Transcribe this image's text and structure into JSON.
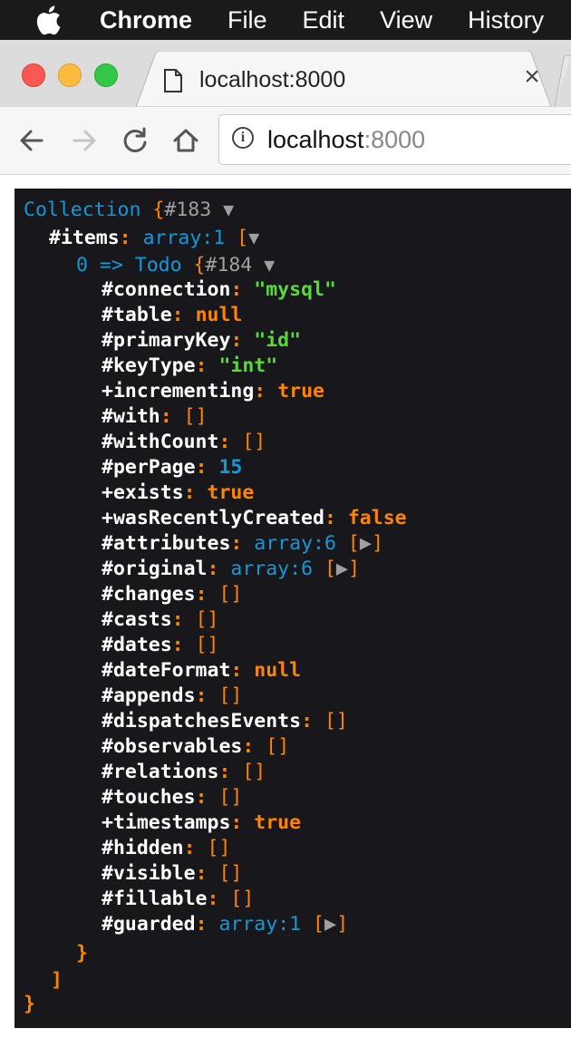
{
  "menubar": {
    "app_name": "Chrome",
    "items": [
      "File",
      "Edit",
      "View",
      "History"
    ]
  },
  "tab": {
    "title": "localhost:8000",
    "close_symbol": "×"
  },
  "omnibox": {
    "host": "localhost",
    "port": ":8000"
  },
  "dump": {
    "root_class": "Collection",
    "root_ref": "#183",
    "items_key": "#items",
    "items_type": "array:1",
    "item_index": "0",
    "arrow": "=>",
    "item_class": "Todo",
    "item_ref": "#184",
    "properties": [
      {
        "key": "#connection",
        "type": "string",
        "value": "\"mysql\""
      },
      {
        "key": "#table",
        "type": "null",
        "value": "null"
      },
      {
        "key": "#primaryKey",
        "type": "string",
        "value": "\"id\""
      },
      {
        "key": "#keyType",
        "type": "string",
        "value": "\"int\""
      },
      {
        "key": "+incrementing",
        "type": "bool",
        "value": "true"
      },
      {
        "key": "#with",
        "type": "empty",
        "value": "[]"
      },
      {
        "key": "#withCount",
        "type": "empty",
        "value": "[]"
      },
      {
        "key": "#perPage",
        "type": "number",
        "value": "15"
      },
      {
        "key": "+exists",
        "type": "bool",
        "value": "true"
      },
      {
        "key": "+wasRecentlyCreated",
        "type": "bool",
        "value": "false"
      },
      {
        "key": "#attributes",
        "type": "array",
        "value": "array:6"
      },
      {
        "key": "#original",
        "type": "array",
        "value": "array:6"
      },
      {
        "key": "#changes",
        "type": "empty",
        "value": "[]"
      },
      {
        "key": "#casts",
        "type": "empty",
        "value": "[]"
      },
      {
        "key": "#dates",
        "type": "empty",
        "value": "[]"
      },
      {
        "key": "#dateFormat",
        "type": "null",
        "value": "null"
      },
      {
        "key": "#appends",
        "type": "empty",
        "value": "[]"
      },
      {
        "key": "#dispatchesEvents",
        "type": "empty",
        "value": "[]"
      },
      {
        "key": "#observables",
        "type": "empty",
        "value": "[]"
      },
      {
        "key": "#relations",
        "type": "empty",
        "value": "[]"
      },
      {
        "key": "#touches",
        "type": "empty",
        "value": "[]"
      },
      {
        "key": "+timestamps",
        "type": "bool",
        "value": "true"
      },
      {
        "key": "#hidden",
        "type": "empty",
        "value": "[]"
      },
      {
        "key": "#visible",
        "type": "empty",
        "value": "[]"
      },
      {
        "key": "#fillable",
        "type": "empty",
        "value": "[]"
      },
      {
        "key": "#guarded",
        "type": "array",
        "value": "array:1"
      }
    ],
    "close_item": "}",
    "close_items": "]",
    "close_root": "}"
  },
  "colors": {
    "panel_bg": "#18171b",
    "key": "#ffffff",
    "punctuation": "#ff8400",
    "class_and_type": "#1299da",
    "string": "#56db3a",
    "ref": "#a0a0a0"
  }
}
